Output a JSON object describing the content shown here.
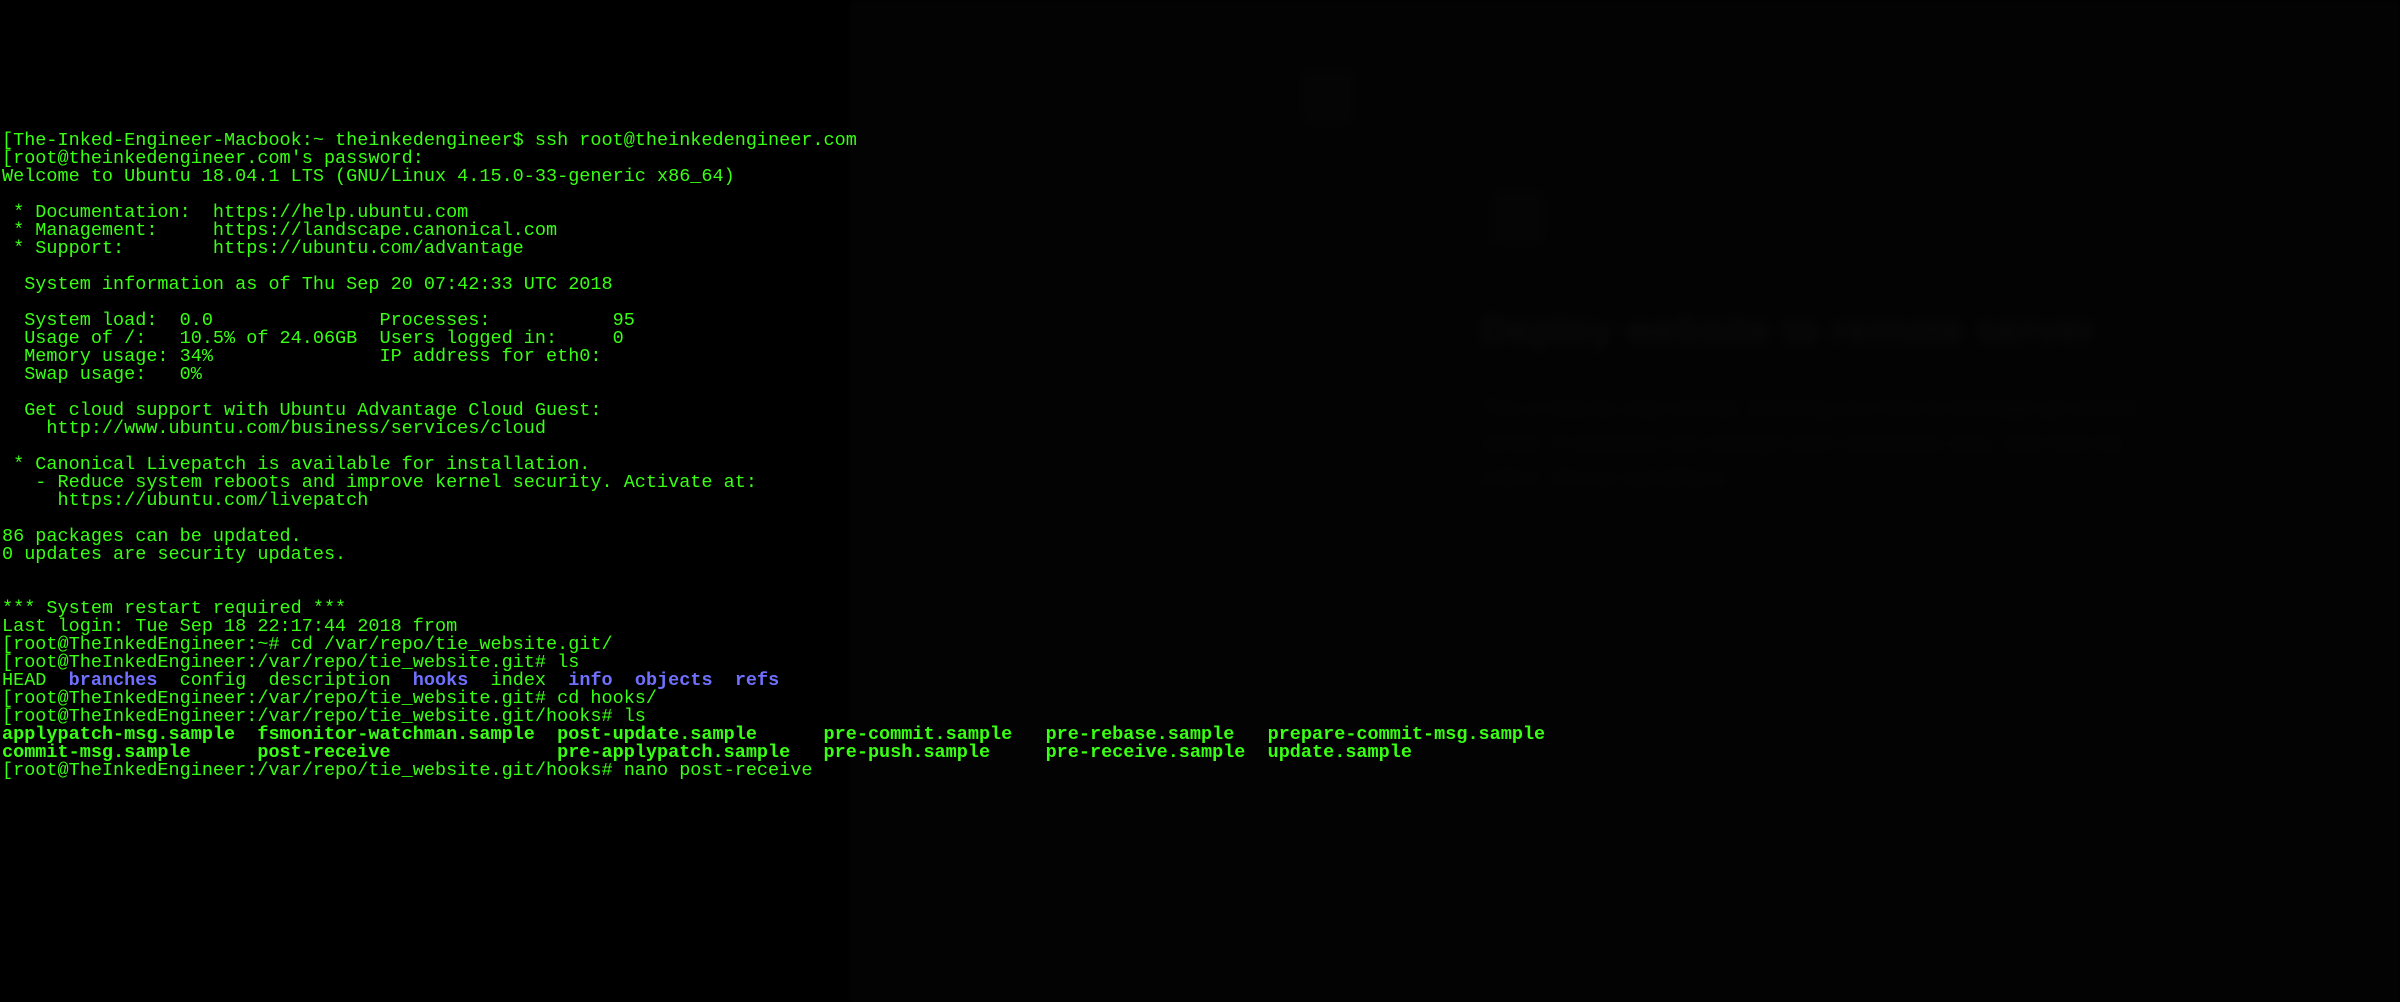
{
  "lines": [
    {
      "segments": [
        {
          "text": "[The-Inked-Engineer-Macbook:~ theinkedengineer$ ssh root@theinkedengineer.com",
          "cls": "green"
        }
      ]
    },
    {
      "segments": [
        {
          "text": "[root@theinkedengineer.com's password:",
          "cls": "green"
        }
      ]
    },
    {
      "segments": [
        {
          "text": "Welcome to Ubuntu 18.04.1 LTS (GNU/Linux 4.15.0-33-generic x86_64)",
          "cls": "green"
        }
      ]
    },
    {
      "segments": [
        {
          "text": "",
          "cls": "green"
        }
      ]
    },
    {
      "segments": [
        {
          "text": " * Documentation:  https://help.ubuntu.com",
          "cls": "green"
        }
      ]
    },
    {
      "segments": [
        {
          "text": " * Management:     https://landscape.canonical.com",
          "cls": "green"
        }
      ]
    },
    {
      "segments": [
        {
          "text": " * Support:        https://ubuntu.com/advantage",
          "cls": "green"
        }
      ]
    },
    {
      "segments": [
        {
          "text": "",
          "cls": "green"
        }
      ]
    },
    {
      "segments": [
        {
          "text": "  System information as of Thu Sep 20 07:42:33 UTC 2018",
          "cls": "green"
        }
      ]
    },
    {
      "segments": [
        {
          "text": "",
          "cls": "green"
        }
      ]
    },
    {
      "segments": [
        {
          "text": "  System load:  0.0               Processes:           95",
          "cls": "green"
        }
      ]
    },
    {
      "segments": [
        {
          "text": "  Usage of /:   10.5% of 24.06GB  Users logged in:     0",
          "cls": "green"
        }
      ]
    },
    {
      "segments": [
        {
          "text": "  Memory usage: 34%               IP address for eth0:",
          "cls": "green"
        }
      ]
    },
    {
      "segments": [
        {
          "text": "  Swap usage:   0%",
          "cls": "green"
        }
      ]
    },
    {
      "segments": [
        {
          "text": "",
          "cls": "green"
        }
      ]
    },
    {
      "segments": [
        {
          "text": "  Get cloud support with Ubuntu Advantage Cloud Guest:",
          "cls": "green"
        }
      ]
    },
    {
      "segments": [
        {
          "text": "    http://www.ubuntu.com/business/services/cloud",
          "cls": "green"
        }
      ]
    },
    {
      "segments": [
        {
          "text": "",
          "cls": "green"
        }
      ]
    },
    {
      "segments": [
        {
          "text": " * Canonical Livepatch is available for installation.",
          "cls": "green"
        }
      ]
    },
    {
      "segments": [
        {
          "text": "   - Reduce system reboots and improve kernel security. Activate at:",
          "cls": "green"
        }
      ]
    },
    {
      "segments": [
        {
          "text": "     https://ubuntu.com/livepatch",
          "cls": "green"
        }
      ]
    },
    {
      "segments": [
        {
          "text": "",
          "cls": "green"
        }
      ]
    },
    {
      "segments": [
        {
          "text": "86 packages can be updated.",
          "cls": "green"
        }
      ]
    },
    {
      "segments": [
        {
          "text": "0 updates are security updates.",
          "cls": "green"
        }
      ]
    },
    {
      "segments": [
        {
          "text": "",
          "cls": "green"
        }
      ]
    },
    {
      "segments": [
        {
          "text": "",
          "cls": "green"
        }
      ]
    },
    {
      "segments": [
        {
          "text": "*** System restart required ***",
          "cls": "green"
        }
      ]
    },
    {
      "segments": [
        {
          "text": "Last login: Tue Sep 18 22:17:44 2018 from",
          "cls": "green"
        }
      ]
    },
    {
      "segments": [
        {
          "text": "[root@TheInkedEngineer:~# cd /var/repo/tie_website.git/",
          "cls": "green"
        }
      ]
    },
    {
      "segments": [
        {
          "text": "[root@TheInkedEngineer:/var/repo/tie_website.git# ls",
          "cls": "green"
        }
      ]
    },
    {
      "segments": [
        {
          "text": "HEAD  ",
          "cls": "green"
        },
        {
          "text": "branches",
          "cls": "blue bold"
        },
        {
          "text": "  config  description  ",
          "cls": "green"
        },
        {
          "text": "hooks",
          "cls": "blue bold"
        },
        {
          "text": "  index  ",
          "cls": "green"
        },
        {
          "text": "info",
          "cls": "blue bold"
        },
        {
          "text": "  ",
          "cls": "green"
        },
        {
          "text": "objects",
          "cls": "blue bold"
        },
        {
          "text": "  ",
          "cls": "green"
        },
        {
          "text": "refs",
          "cls": "blue bold"
        }
      ]
    },
    {
      "segments": [
        {
          "text": "[root@TheInkedEngineer:/var/repo/tie_website.git# cd hooks/",
          "cls": "green"
        }
      ]
    },
    {
      "segments": [
        {
          "text": "[root@TheInkedEngineer:/var/repo/tie_website.git/hooks# ls",
          "cls": "green"
        }
      ]
    },
    {
      "segments": [
        {
          "text": "applypatch-msg.sample  fsmonitor-watchman.sample  post-update.sample      pre-commit.sample   pre-rebase.sample   prepare-commit-msg.sample",
          "cls": "green bold"
        }
      ]
    },
    {
      "segments": [
        {
          "text": "commit-msg.sample      post-receive               pre-applypatch.sample   pre-push.sample     pre-receive.sample  update.sample",
          "cls": "green bold"
        }
      ]
    },
    {
      "segments": [
        {
          "text": "[root@TheInkedEngineer:/var/repo/tie_website.git/hooks# nano post-receive",
          "cls": "green"
        }
      ]
    }
  ],
  "background": {
    "heading": "Deploy website to remote server",
    "para": "This a step by step tutorial, teaching you how to leverage git remote server. It will guide you through each necessary step. Also find me online. Git me somethere."
  }
}
